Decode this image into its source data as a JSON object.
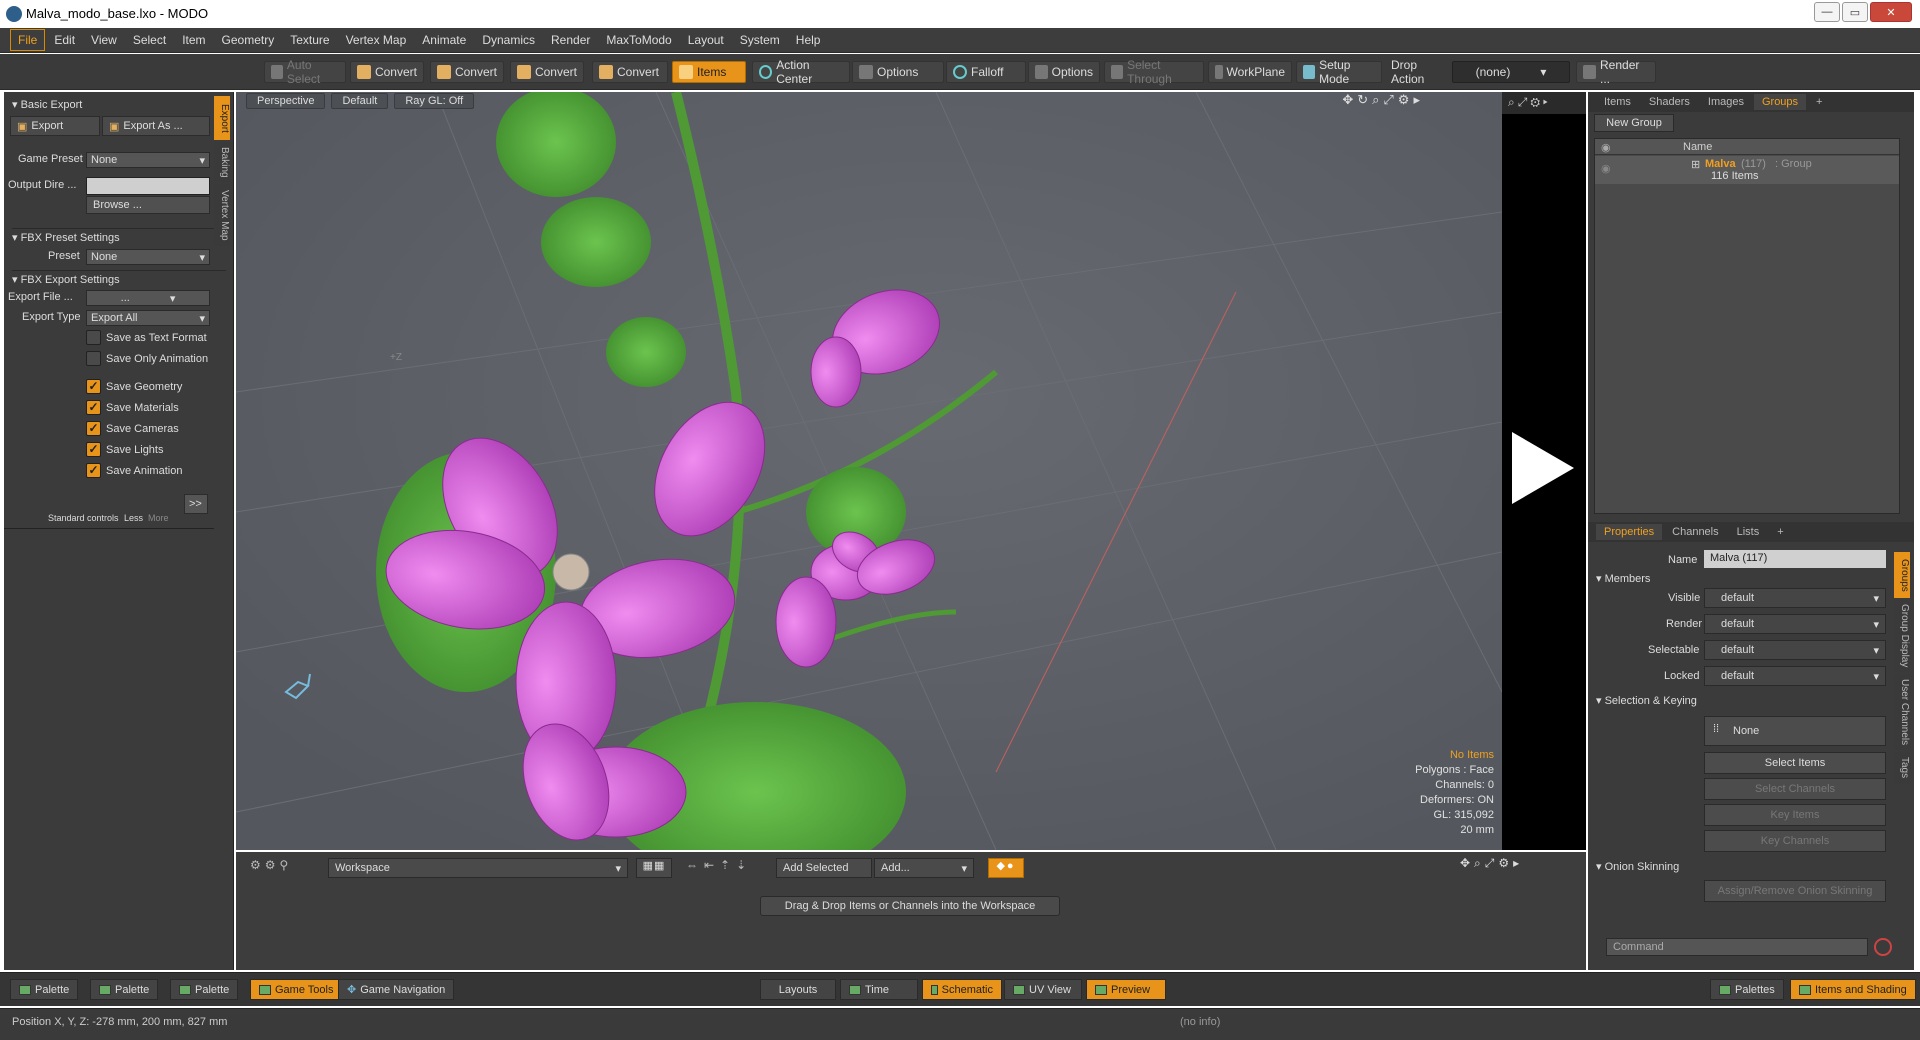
{
  "window": {
    "title": "Malva_modo_base.lxo - MODO",
    "controls": [
      "—",
      "▭",
      "✕"
    ]
  },
  "menu": [
    "File",
    "Edit",
    "View",
    "Select",
    "Item",
    "Geometry",
    "Texture",
    "Vertex Map",
    "Animate",
    "Dynamics",
    "Render",
    "MaxToModo",
    "Layout",
    "System",
    "Help"
  ],
  "toolbar": {
    "auto_select": "Auto Select",
    "convert1": "Convert",
    "convert2": "Convert",
    "convert3": "Convert",
    "convert4": "Convert",
    "items": "Items",
    "action_center": "Action Center",
    "options1": "Options",
    "falloff": "Falloff",
    "options2": "Options",
    "select_through": "Select Through",
    "workplane": "WorkPlane",
    "setup_mode": "Setup Mode",
    "drop_action": "Drop Action",
    "drop_value": "(none)",
    "render": "Render ..."
  },
  "left": {
    "basic_export": "Basic Export",
    "export": "Export",
    "export_as": "Export As ...",
    "game_preset_label": "Game Preset",
    "game_preset_value": "None",
    "output_dir_label": "Output Dire ...",
    "browse": "Browse ...",
    "fbx_preset_settings": "FBX Preset Settings",
    "preset_label": "Preset",
    "preset_value": "None",
    "fbx_export_settings": "FBX Export Settings",
    "export_file_label": "Export File ...",
    "export_file_value": "...",
    "export_type_label": "Export Type",
    "export_type_value": "Export All",
    "save_text": "Save as Text Format",
    "save_anim_only": "Save Only Animation",
    "save_geometry": "Save Geometry",
    "save_materials": "Save Materials",
    "save_cameras": "Save Cameras",
    "save_lights": "Save Lights",
    "save_animation": "Save Animation",
    "expand": ">>",
    "standard_controls": "Standard controls",
    "less": "Less",
    "more": "More",
    "vtabs": [
      "Export",
      "Baking",
      "Vertex Map"
    ]
  },
  "viewport": {
    "perspective": "Perspective",
    "default": "Default",
    "raygl": "Ray GL: Off",
    "axis_label": "+Z",
    "info": {
      "no_items": "No Items",
      "polygons": "Polygons : Face",
      "channels": "Channels: 0",
      "deformers": "Deformers: ON",
      "gl": "GL: 315,092",
      "scale": "20 mm"
    }
  },
  "workspace": {
    "dropdown": "Workspace",
    "add_selected": "Add Selected",
    "add": "Add...",
    "hint": "Drag & Drop Items or Channels into the Workspace"
  },
  "right": {
    "tabs": [
      "Items",
      "Shaders",
      "Images",
      "Groups"
    ],
    "plus": "+",
    "new_group": "New Group",
    "col_name": "Name",
    "group_name": "Malva",
    "group_count": "(117)",
    "group_type": ": Group",
    "group_items": "116 Items",
    "prop_tabs": [
      "Properties",
      "Channels",
      "Lists"
    ],
    "name_label": "Name",
    "name_value": "Malva (117)",
    "members": "Members",
    "visible_label": "Visible",
    "render_label": "Render",
    "selectable_label": "Selectable",
    "locked_label": "Locked",
    "default": "default",
    "selection_keying": "Selection & Keying",
    "none": "None",
    "select_items": "Select Items",
    "select_channels": "Select Channels",
    "key_items": "Key Items",
    "key_channels": "Key Channels",
    "onion": "Onion Skinning",
    "assign_onion": "Assign/Remove Onion Skinning",
    "command": "Command",
    "vtabs": [
      "Groups",
      "Group Display",
      "User Channels",
      "Tags"
    ]
  },
  "bottom": {
    "palette1": "Palette",
    "palette2": "Palette",
    "palette3": "Palette",
    "game_tools": "Game Tools",
    "game_nav": "Game Navigation",
    "layouts": "Layouts",
    "time": "Time",
    "schematic": "Schematic",
    "uv_view": "UV View",
    "preview": "Preview",
    "palettes": "Palettes",
    "items_shading": "Items and Shading"
  },
  "status": {
    "position": "Position X, Y, Z:  -278 mm, 200 mm, 827 mm",
    "info": "(no info)"
  }
}
